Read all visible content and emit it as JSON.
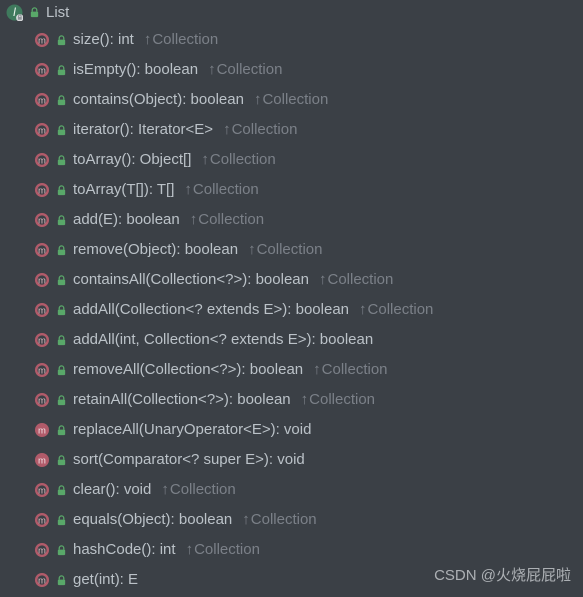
{
  "header": {
    "title": "List"
  },
  "methods": [
    {
      "sig": "size(): int",
      "inherit": "Collection"
    },
    {
      "sig": "isEmpty(): boolean",
      "inherit": "Collection"
    },
    {
      "sig": "contains(Object): boolean",
      "inherit": "Collection"
    },
    {
      "sig": "iterator(): Iterator<E>",
      "inherit": "Collection"
    },
    {
      "sig": "toArray(): Object[]",
      "inherit": "Collection"
    },
    {
      "sig": "toArray(T[]): T[]",
      "inherit": "Collection"
    },
    {
      "sig": "add(E): boolean",
      "inherit": "Collection"
    },
    {
      "sig": "remove(Object): boolean",
      "inherit": "Collection"
    },
    {
      "sig": "containsAll(Collection<?>): boolean",
      "inherit": "Collection"
    },
    {
      "sig": "addAll(Collection<? extends E>): boolean",
      "inherit": "Collection"
    },
    {
      "sig": "addAll(int, Collection<? extends E>): boolean",
      "inherit": null
    },
    {
      "sig": "removeAll(Collection<?>): boolean",
      "inherit": "Collection"
    },
    {
      "sig": "retainAll(Collection<?>): boolean",
      "inherit": "Collection"
    },
    {
      "sig": "replaceAll(UnaryOperator<E>): void",
      "inherit": null,
      "default": true
    },
    {
      "sig": "sort(Comparator<? super E>): void",
      "inherit": null,
      "default": true
    },
    {
      "sig": "clear(): void",
      "inherit": "Collection"
    },
    {
      "sig": "equals(Object): boolean",
      "inherit": "Collection"
    },
    {
      "sig": "hashCode(): int",
      "inherit": "Collection"
    },
    {
      "sig": "get(int): E",
      "inherit": null
    }
  ],
  "watermark": "CSDN @火烧屁屁啦",
  "icons": {
    "interface": "I",
    "method": "m"
  },
  "colors": {
    "interface_bg": "#4e9a6f",
    "method_bg": "#c75d6f",
    "lock_fg": "#59a869",
    "text": "#bbc2c8",
    "inherit": "#7b8088",
    "bg": "#3b4046"
  }
}
